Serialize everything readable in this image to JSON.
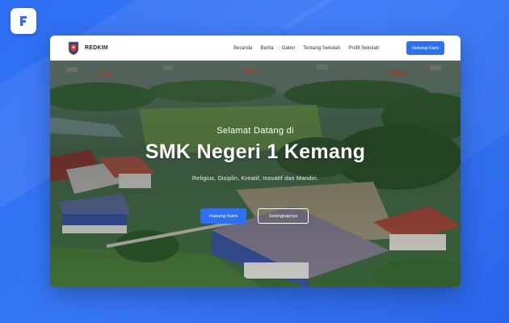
{
  "app_logo": {
    "letter": "F",
    "icon": "f-logo-icon",
    "color": "#2f6ff2"
  },
  "navbar": {
    "brand_name": "REDKIM",
    "brand_icon": "school-emblem-icon",
    "links": [
      "Beranda",
      "Berita",
      "Galeri",
      "Tentang Sekolah",
      "Profil Sekolah"
    ],
    "cta_label": "Hubungi Kami"
  },
  "hero": {
    "welcome": "Selamat Datang di",
    "title": "SMK Negeri 1 Kemang",
    "tagline": "Religius, Disiplin, Kreatif, Inovatif dan Mandiri.",
    "primary_button": "Hubungi Kami",
    "secondary_button": "Selengkapnya",
    "background": "aerial-school-photo"
  },
  "colors": {
    "accent": "#2f6ff2",
    "page_background": "#2f6ff2",
    "navbar_background": "#ffffff",
    "text_dark": "#1c2536"
  }
}
